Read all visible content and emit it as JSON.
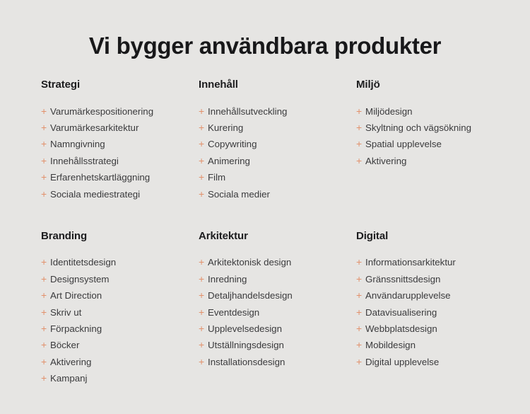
{
  "page": {
    "background_color": "#e6e5e3",
    "title": "Vi bygger användbara produkter",
    "accent_color": "#e2916c",
    "heading_color": "#18181a",
    "item_text_color": "#3b3b3d",
    "bullet_glyph": "+"
  },
  "columns": [
    {
      "title": "Strategi",
      "items": [
        "Varumärkespositionering",
        "Varumärkesarkitektur",
        "Namngivning",
        "Innehållsstrategi",
        "Erfarenhetskartläggning",
        "Sociala mediestrategi"
      ]
    },
    {
      "title": "Innehåll",
      "items": [
        "Innehållsutveckling",
        "Kurering",
        "Copywriting",
        "Animering",
        "Film",
        "Sociala medier"
      ]
    },
    {
      "title": "Miljö",
      "items": [
        "Miljödesign",
        "Skyltning och vägsökning",
        "Spatial upplevelse",
        "Aktivering"
      ]
    },
    {
      "title": "Branding",
      "items": [
        "Identitetsdesign",
        "Designsystem",
        "Art Direction",
        "Skriv ut",
        "Förpackning",
        "Böcker",
        "Aktivering",
        "Kampanj"
      ]
    },
    {
      "title": "Arkitektur",
      "items": [
        "Arkitektonisk design",
        "Inredning",
        "Detaljhandelsdesign",
        "Eventdesign",
        "Upplevelsedesign",
        "Utställningsdesign",
        "Installationsdesign"
      ]
    },
    {
      "title": "Digital",
      "items": [
        "Informationsarkitektur",
        "Gränssnittsdesign",
        "Användarupplevelse",
        "Datavisualisering",
        "Webbplatsdesign",
        "Mobildesign",
        "Digital upplevelse"
      ]
    }
  ]
}
